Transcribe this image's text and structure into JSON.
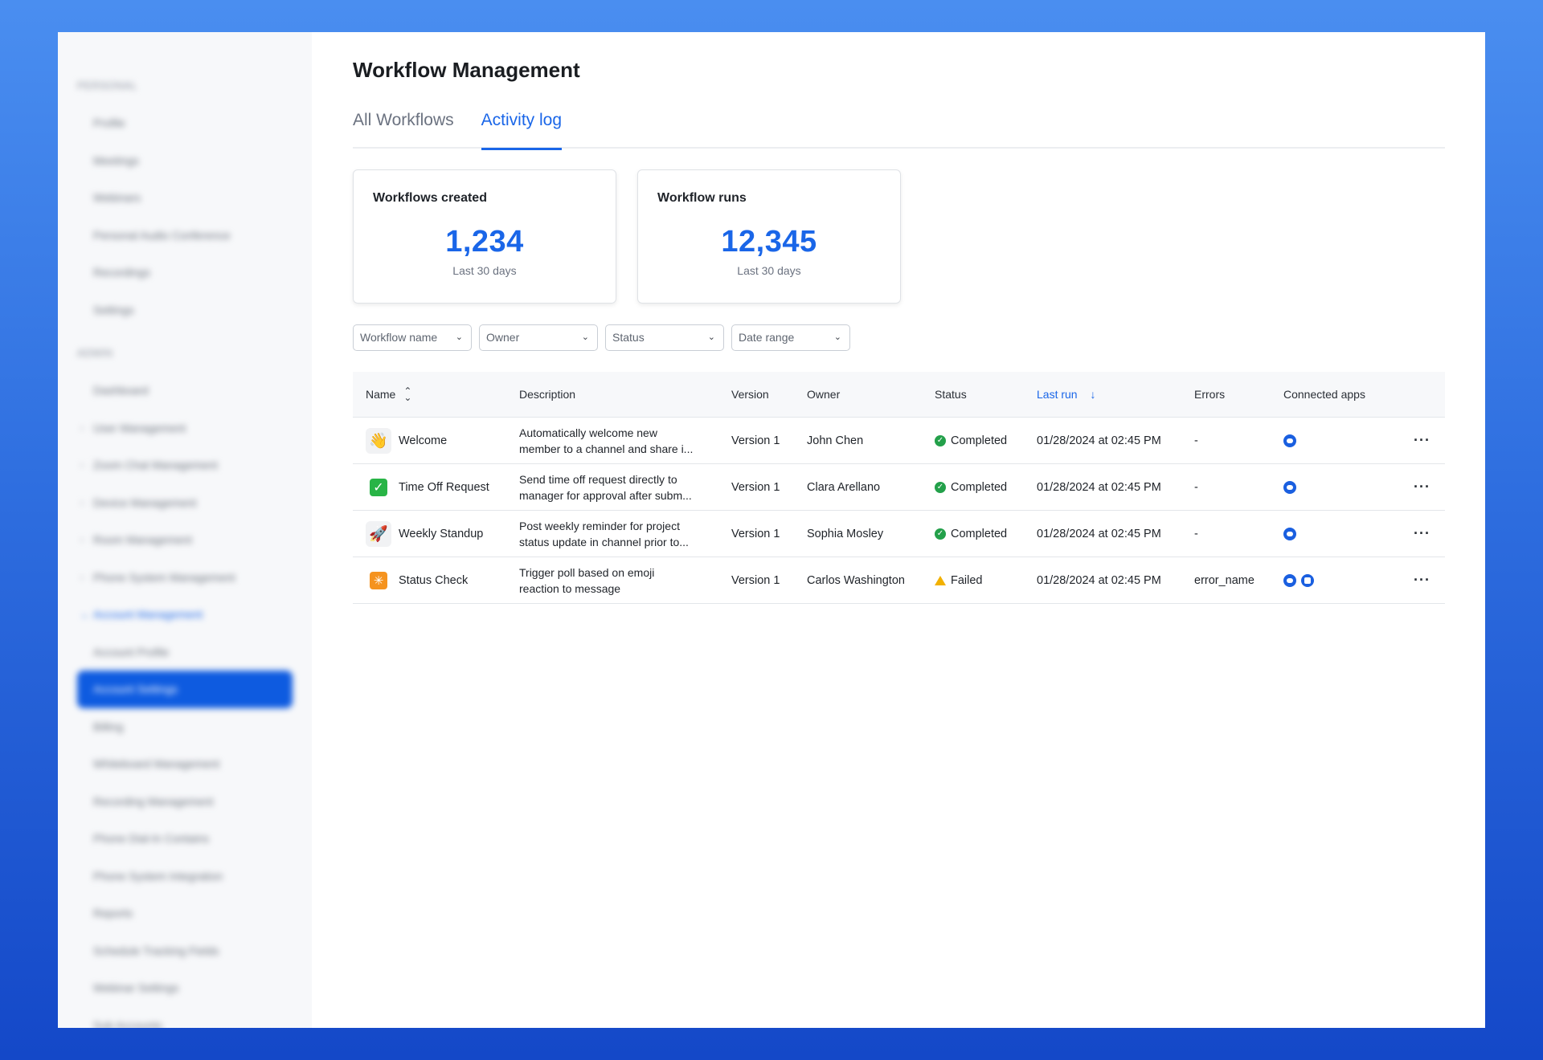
{
  "sidebar": {
    "sections": [
      {
        "title": "PERSONAL",
        "items": [
          {
            "label": "Profile"
          },
          {
            "label": "Meetings"
          },
          {
            "label": "Webinars"
          },
          {
            "label": "Personal Audio Conference"
          },
          {
            "label": "Recordings"
          },
          {
            "label": "Settings"
          }
        ]
      },
      {
        "title": "ADMIN",
        "items": [
          {
            "label": "Dashboard"
          },
          {
            "label": "User Management",
            "chevron": "›"
          },
          {
            "label": "Zoom Chat Management",
            "chevron": "›"
          },
          {
            "label": "Device Management",
            "chevron": "›"
          },
          {
            "label": "Room Management",
            "chevron": "›"
          },
          {
            "label": "Phone System Management",
            "chevron": "›"
          },
          {
            "label": "Account Management",
            "chevron": "⌄"
          },
          {
            "label": "Account Profile"
          },
          {
            "label": "Account Settings"
          },
          {
            "label": "Billing"
          },
          {
            "label": "Whiteboard Management"
          },
          {
            "label": "Recording Management"
          },
          {
            "label": "Phone Dial-In Contains"
          },
          {
            "label": "Phone System Integration"
          },
          {
            "label": "Reports"
          },
          {
            "label": "Schedule Tracking Fields"
          },
          {
            "label": "Webinar Settings"
          },
          {
            "label": "Sub Accounts"
          }
        ]
      }
    ]
  },
  "header": {
    "title": "Workflow Management"
  },
  "tabs": [
    {
      "label": "All Workflows"
    },
    {
      "label": "Activity log"
    }
  ],
  "cards": [
    {
      "label": "Workflows created",
      "value": "1,234",
      "sub": "Last 30 days"
    },
    {
      "label": "Workflow runs",
      "value": "12,345",
      "sub": "Last 30 days"
    }
  ],
  "filters": [
    {
      "label": "Workflow name"
    },
    {
      "label": "Owner"
    },
    {
      "label": "Status"
    },
    {
      "label": "Date range"
    }
  ],
  "table": {
    "columns": {
      "name": "Name",
      "description": "Description",
      "version": "Version",
      "owner": "Owner",
      "status": "Status",
      "last_run": "Last run",
      "errors": "Errors",
      "apps": "Connected apps"
    },
    "rows": [
      {
        "emoji": "👋",
        "name": "Welcome",
        "desc1": "Automatically welcome new",
        "desc2": "member to a channel and share i...",
        "version": "Version 1",
        "owner": "John Chen",
        "status": "Completed",
        "last_run": "01/28/2024 at 02:45 PM",
        "errors": "-"
      },
      {
        "emoji": "✓",
        "name": "Time Off Request",
        "desc1": "Send time off request directly to",
        "desc2": "manager for approval after subm...",
        "version": "Version 1",
        "owner": "Clara Arellano",
        "status": "Completed",
        "last_run": "01/28/2024 at 02:45 PM",
        "errors": "-"
      },
      {
        "emoji": "🚀",
        "name": "Weekly Standup",
        "desc1": "Post weekly reminder for project",
        "desc2": "status update in channel prior to...",
        "version": "Version 1",
        "owner": "Sophia Mosley",
        "status": "Completed",
        "last_run": "01/28/2024 at 02:45 PM",
        "errors": "-"
      },
      {
        "emoji": "✳",
        "name": "Status Check",
        "desc1": "Trigger poll based on emoji",
        "desc2": "reaction to message",
        "version": "Version 1",
        "owner": "Carlos Washington",
        "status": "Failed",
        "last_run": "01/28/2024 at 02:45 PM",
        "errors": "error_name"
      }
    ],
    "more_label": "···"
  },
  "colors": {
    "accent": "#1a66e8",
    "success": "#23a04a",
    "warning": "#f2b100"
  }
}
